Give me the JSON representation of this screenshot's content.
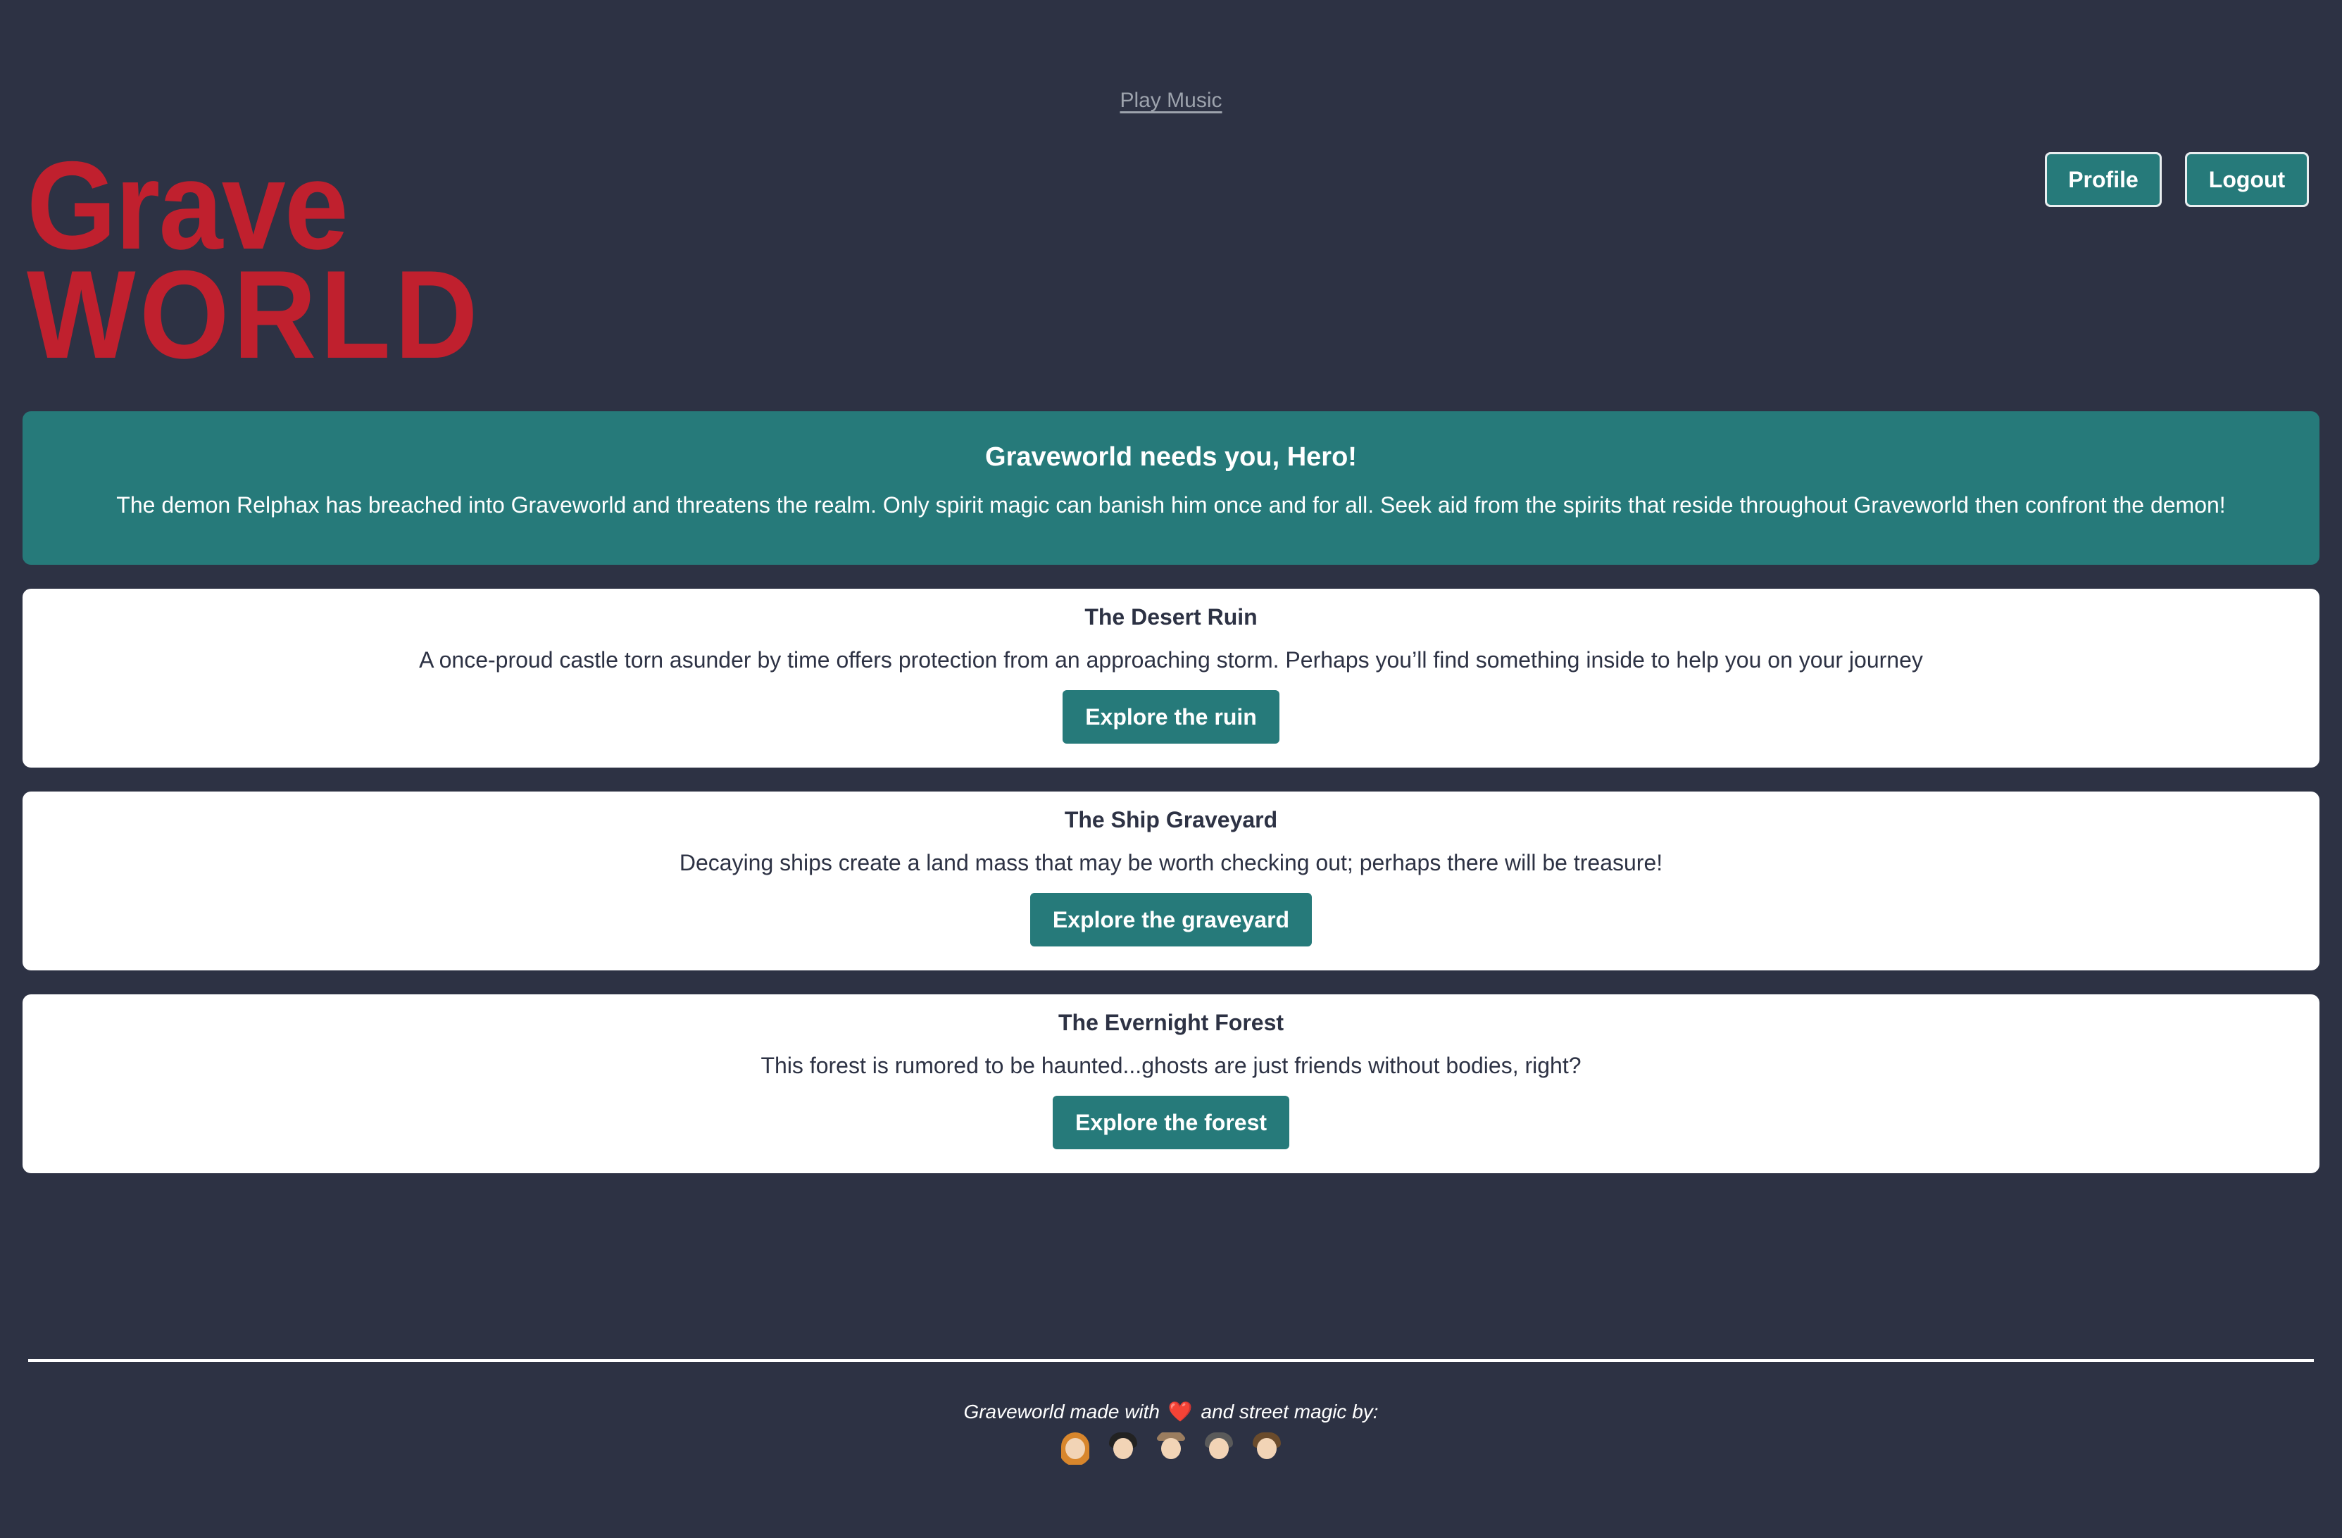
{
  "header": {
    "music_link": "Play Music",
    "logo_line1": "Grave",
    "logo_line2": "WORLD",
    "profile_label": "Profile",
    "logout_label": "Logout"
  },
  "hero": {
    "title": "Graveworld needs you, Hero!",
    "text": "The demon Relphax has breached into Graveworld and threatens the realm. Only spirit magic can banish him once and for all. Seek aid from the spirits that reside throughout Graveworld then confront the demon!"
  },
  "locations": [
    {
      "title": "The Desert Ruin",
      "text": "A once-proud castle torn asunder by time offers protection from an approaching storm. Perhaps you’ll find something inside to help you on your journey",
      "button": "Explore the ruin"
    },
    {
      "title": "The Ship Graveyard",
      "text": "Decaying ships create a land mass that may be worth checking out; perhaps there will be treasure!",
      "button": "Explore the graveyard"
    },
    {
      "title": "The Evernight Forest",
      "text": "This forest is rumored to be haunted...ghosts are just friends without bodies, right?",
      "button": "Explore the forest"
    }
  ],
  "footer": {
    "text_before": "Graveworld made with",
    "heart": "❤️",
    "text_after": "and street magic by:",
    "avatars": [
      "avatar-1",
      "avatar-2",
      "avatar-3",
      "avatar-4",
      "avatar-5"
    ]
  },
  "colors": {
    "background": "#2d3244",
    "accent": "#267a7a",
    "logo": "#c0202e",
    "card": "#ffffff"
  }
}
